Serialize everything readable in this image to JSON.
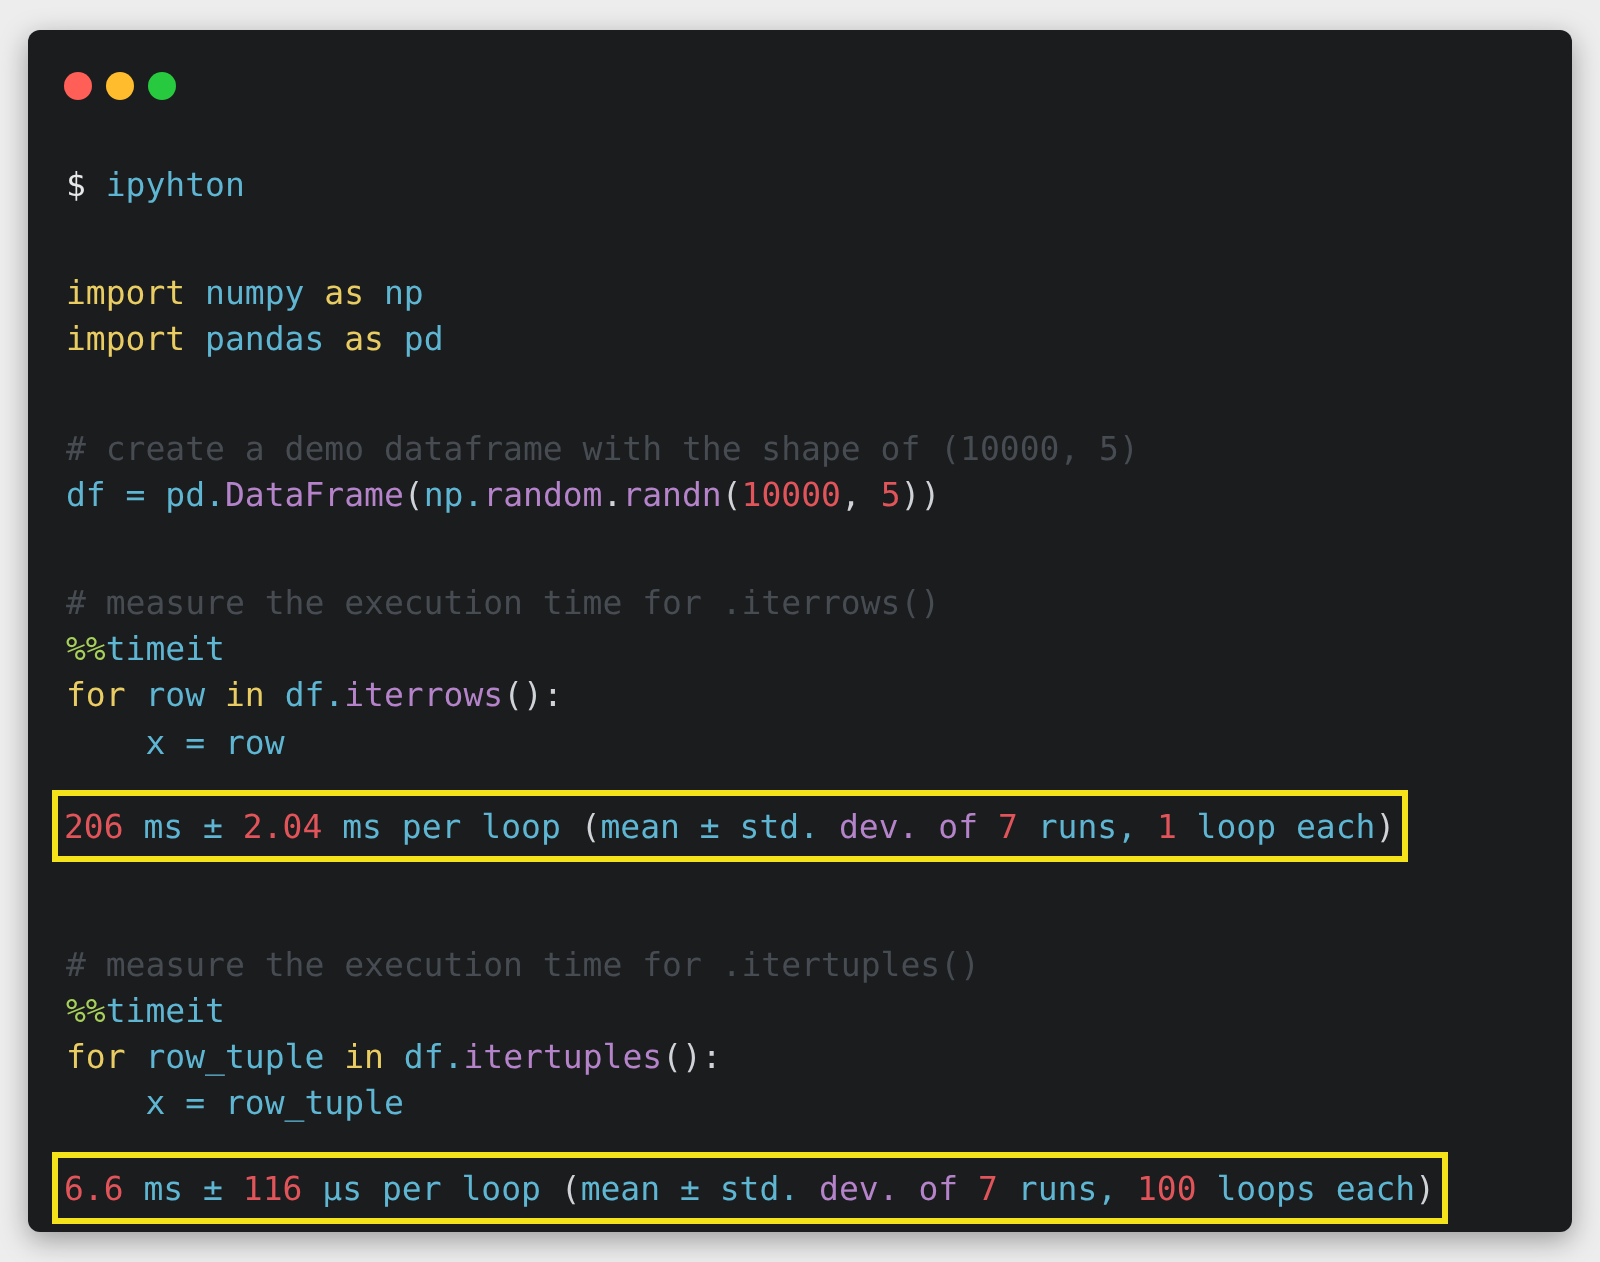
{
  "window": {
    "controls": [
      {
        "color": "#ff5f56"
      },
      {
        "color": "#ffbd2e"
      },
      {
        "color": "#27c93f"
      }
    ]
  },
  "blocks": [
    {
      "kind": "code",
      "lines": [
        [
          {
            "t": "$ ",
            "kind": "plain"
          },
          {
            "t": "ipyhton",
            "kind": "name"
          }
        ]
      ]
    },
    {
      "kind": "code",
      "lines": [
        [
          {
            "t": "import ",
            "kind": "kw"
          },
          {
            "t": "numpy ",
            "kind": "name"
          },
          {
            "t": "as ",
            "kind": "kw"
          },
          {
            "t": "np",
            "kind": "name"
          }
        ],
        [
          {
            "t": "import ",
            "kind": "kw"
          },
          {
            "t": "pandas ",
            "kind": "name"
          },
          {
            "t": "as ",
            "kind": "kw"
          },
          {
            "t": "pd",
            "kind": "name"
          }
        ]
      ]
    },
    {
      "kind": "code",
      "lines": [
        [
          {
            "t": "# create a demo dataframe with the shape of (10000, 5)",
            "kind": "comment"
          }
        ],
        [
          {
            "t": "df = pd.",
            "kind": "name"
          },
          {
            "t": "DataFrame",
            "kind": "fn"
          },
          {
            "t": "(",
            "kind": "punct"
          },
          {
            "t": "np.",
            "kind": "name"
          },
          {
            "t": "random",
            "kind": "fn"
          },
          {
            "t": ".",
            "kind": "punct"
          },
          {
            "t": "randn",
            "kind": "fn"
          },
          {
            "t": "(",
            "kind": "punct"
          },
          {
            "t": "10000",
            "kind": "num"
          },
          {
            "t": ", ",
            "kind": "punct"
          },
          {
            "t": "5",
            "kind": "num"
          },
          {
            "t": "))",
            "kind": "punct"
          }
        ]
      ]
    },
    {
      "kind": "code",
      "lines": [
        [
          {
            "t": "# measure the execution time for .iterrows()",
            "kind": "comment"
          }
        ],
        [
          {
            "t": "%%",
            "kind": "magic"
          },
          {
            "t": "timeit",
            "kind": "name"
          }
        ],
        [
          {
            "t": "for ",
            "kind": "kw"
          },
          {
            "t": "row ",
            "kind": "name"
          },
          {
            "t": "in ",
            "kind": "kw"
          },
          {
            "t": "df.",
            "kind": "name"
          },
          {
            "t": "iterrows",
            "kind": "fn"
          },
          {
            "t": "():",
            "kind": "punct"
          }
        ],
        [
          {
            "t": "    x = row",
            "kind": "name"
          }
        ]
      ]
    },
    {
      "kind": "output",
      "lines": [
        [
          {
            "t": "206",
            "kind": "num"
          },
          {
            "t": " ms ± ",
            "kind": "name"
          },
          {
            "t": "2.04",
            "kind": "num"
          },
          {
            "t": " ms per loop ",
            "kind": "name"
          },
          {
            "t": "(",
            "kind": "punct"
          },
          {
            "t": "mean ± std. ",
            "kind": "name"
          },
          {
            "t": "dev. of ",
            "kind": "fn"
          },
          {
            "t": "7",
            "kind": "num"
          },
          {
            "t": " runs, ",
            "kind": "name"
          },
          {
            "t": "1",
            "kind": "num"
          },
          {
            "t": " loop each",
            "kind": "name"
          },
          {
            "t": ")",
            "kind": "punct"
          }
        ]
      ]
    },
    {
      "kind": "code",
      "lines": [
        [
          {
            "t": "# measure the execution time for .itertuples()",
            "kind": "comment"
          }
        ],
        [
          {
            "t": "%%",
            "kind": "magic"
          },
          {
            "t": "timeit",
            "kind": "name"
          }
        ],
        [
          {
            "t": "for ",
            "kind": "kw"
          },
          {
            "t": "row_tuple ",
            "kind": "name"
          },
          {
            "t": "in ",
            "kind": "kw"
          },
          {
            "t": "df.",
            "kind": "name"
          },
          {
            "t": "itertuples",
            "kind": "fn"
          },
          {
            "t": "():",
            "kind": "punct"
          }
        ],
        [
          {
            "t": "    x = row_tuple",
            "kind": "name"
          }
        ]
      ]
    },
    {
      "kind": "output",
      "lines": [
        [
          {
            "t": "6.6",
            "kind": "num"
          },
          {
            "t": " ms ± ",
            "kind": "name"
          },
          {
            "t": "116",
            "kind": "num"
          },
          {
            "t": " µs per loop ",
            "kind": "name"
          },
          {
            "t": "(",
            "kind": "punct"
          },
          {
            "t": "mean ± std. ",
            "kind": "name"
          },
          {
            "t": "dev. of ",
            "kind": "fn"
          },
          {
            "t": "7",
            "kind": "num"
          },
          {
            "t": " runs, ",
            "kind": "name"
          },
          {
            "t": "100",
            "kind": "num"
          },
          {
            "t": " loops each",
            "kind": "name"
          },
          {
            "t": ")",
            "kind": "punct"
          }
        ]
      ]
    }
  ]
}
